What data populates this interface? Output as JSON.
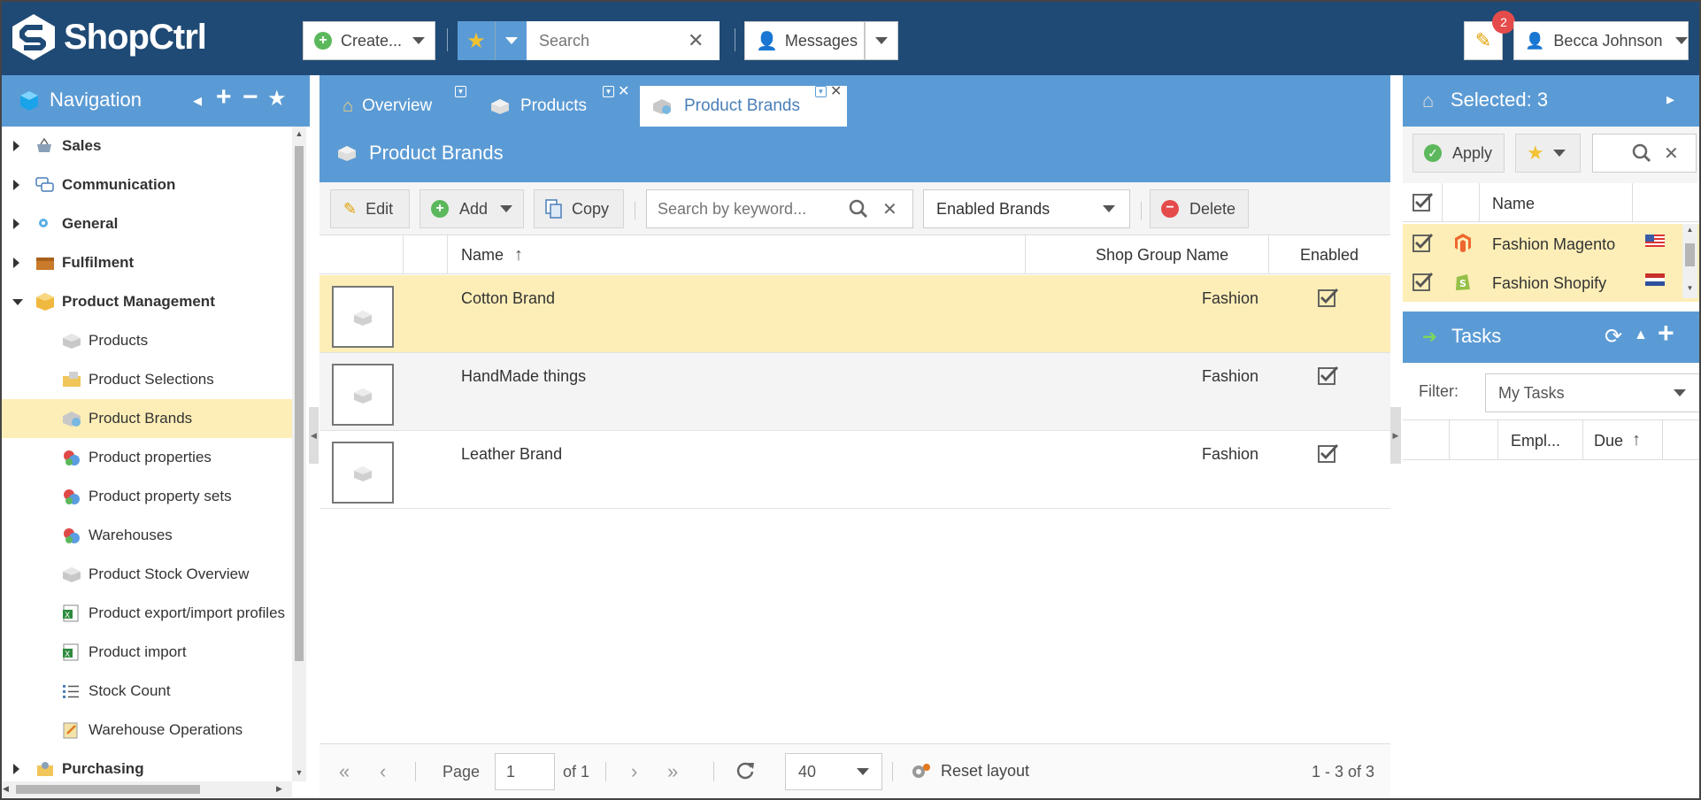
{
  "app": {
    "logo_text": "ShopCtrl"
  },
  "topbar": {
    "create_label": "Create...",
    "search_placeholder": "Search",
    "messages_label": "Messages",
    "notifications_count": "2",
    "user_name": "Becca Johnson"
  },
  "nav": {
    "title": "Navigation",
    "items": [
      {
        "label": "Sales",
        "level": 0,
        "expanded": false
      },
      {
        "label": "Communication",
        "level": 0,
        "expanded": false
      },
      {
        "label": "General",
        "level": 0,
        "expanded": false
      },
      {
        "label": "Fulfilment",
        "level": 0,
        "expanded": false
      },
      {
        "label": "Product Management",
        "level": 0,
        "expanded": true
      },
      {
        "label": "Products",
        "level": 1
      },
      {
        "label": "Product Selections",
        "level": 1
      },
      {
        "label": "Product Brands",
        "level": 1,
        "selected": true
      },
      {
        "label": "Product properties",
        "level": 1
      },
      {
        "label": "Product property sets",
        "level": 1
      },
      {
        "label": "Warehouses",
        "level": 1
      },
      {
        "label": "Product Stock Overview",
        "level": 1
      },
      {
        "label": "Product export/import profiles",
        "level": 1
      },
      {
        "label": "Product import",
        "level": 1
      },
      {
        "label": "Stock Count",
        "level": 1
      },
      {
        "label": "Warehouse Operations",
        "level": 1
      },
      {
        "label": "Purchasing",
        "level": 0,
        "expanded": false
      }
    ]
  },
  "tabs": [
    {
      "label": "Overview"
    },
    {
      "label": "Products"
    },
    {
      "label": "Product Brands",
      "active": true
    }
  ],
  "panel": {
    "title": "Product Brands"
  },
  "toolbar": {
    "edit": "Edit",
    "add": "Add",
    "copy": "Copy",
    "search_placeholder": "Search by keyword...",
    "filter_value": "Enabled Brands",
    "delete": "Delete"
  },
  "grid": {
    "columns": {
      "name": "Name",
      "shop_group": "Shop Group Name",
      "enabled": "Enabled"
    },
    "rows": [
      {
        "name": "Cotton Brand",
        "shop_group": "Fashion",
        "enabled": true,
        "selected": true
      },
      {
        "name": "HandMade things",
        "shop_group": "Fashion",
        "enabled": true
      },
      {
        "name": "Leather Brand",
        "shop_group": "Fashion",
        "enabled": true
      }
    ]
  },
  "pager": {
    "page_label": "Page",
    "page_value": "1",
    "of_label": "of 1",
    "page_size": "40",
    "reset_layout": "Reset layout",
    "summary": "1 - 3 of 3"
  },
  "selected": {
    "title": "Selected: 3",
    "apply": "Apply",
    "col_name": "Name",
    "rows": [
      {
        "name": "Fashion Magento",
        "platform": "magento-icon",
        "flag": "us-flag-icon"
      },
      {
        "name": "Fashion Shopify",
        "platform": "shopify-icon",
        "flag": "nl-flag-icon"
      }
    ]
  },
  "tasks": {
    "title": "Tasks",
    "filter_label": "Filter:",
    "filter_value": "My Tasks",
    "col_employee": "Empl...",
    "col_due": "Due"
  },
  "colors": {
    "header": "#1f4a75",
    "panel": "#5b9bd5",
    "selected_row": "#fdeeb7",
    "accent": "#f1c232"
  }
}
